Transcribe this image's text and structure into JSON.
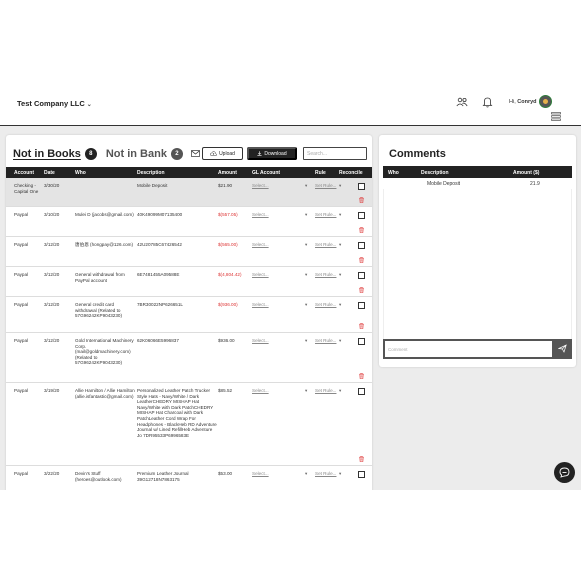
{
  "header": {
    "company": "Test Company LLC",
    "greeting_prefix": "Hi,",
    "user_name": "Conryd"
  },
  "tabs": {
    "not_in_books": {
      "label": "Not in Books",
      "count": "8"
    },
    "not_in_bank": {
      "label": "Not in Bank",
      "count": "2"
    }
  },
  "toolbar": {
    "upload_label": "Upload",
    "download_label": "Download",
    "search_placeholder": "Search..."
  },
  "table": {
    "columns": [
      "Account",
      "Date",
      "Who",
      "Description",
      "Amount",
      "GL Account",
      "Rule",
      "Reconcile"
    ],
    "rows": [
      {
        "account": "Checking - Capital One",
        "date": "3/30/20",
        "who": "",
        "description": "Mobile Deposit",
        "amount": "$21.90",
        "negative": false,
        "gl": "Select...",
        "rule": "Set Rule..."
      },
      {
        "account": "Paypal",
        "date": "3/10/20",
        "who": "Mulei D (jacobs@gmail.com)",
        "description": "40K49099M07135400",
        "amount": "$(557.05)",
        "negative": true,
        "gl": "Select...",
        "rule": "Set Rule..."
      },
      {
        "account": "Paypal",
        "date": "3/12/20",
        "who": "唐伯恩 (hongpay@126.com)",
        "description": "42U20785C67426542",
        "amount": "$(565.00)",
        "negative": true,
        "gl": "Select...",
        "rule": "Set Rule..."
      },
      {
        "account": "Paypal",
        "date": "3/12/20",
        "who": "General withdrawal from PayPal account",
        "description": "6E7481455A09588E",
        "amount": "$(4,804.42)",
        "negative": true,
        "gl": "Select...",
        "rule": "Set Rule..."
      },
      {
        "account": "Paypal",
        "date": "3/12/20",
        "who": "General credit card withdrawal (Related to 57G96242KP9043230)",
        "description": "7BR30022NP626651L",
        "amount": "$(936.00)",
        "negative": true,
        "gl": "Select...",
        "rule": "Set Rule..."
      },
      {
        "account": "Paypal",
        "date": "3/12/20",
        "who": "Gold International Machinery Corp. (mail@goldmachinery.com) (Related to 57G96242KP9043230)",
        "description": "62K06066E5996837",
        "amount": "$936.00",
        "negative": false,
        "gl": "Select...",
        "rule": "Set Rule..."
      },
      {
        "account": "Paypal",
        "date": "3/19/20",
        "who": "Allie Hamilton / Allie Hamilton (allie.isfantastic@gmail.com)",
        "description": "Personalized Leather Patch Trucker Style Hats - Navy/White / Dark LeatherCHEDRY MISHAP Hat Navy/White with Dark PatchCHEDRY MISHAP Hat Charcoal with Dark PatchLeather Cord Wrap For Headphones - BlackHeb RD Adventure Journal w/ Lined RefillHeb Adventure Jo 7DR95533P6996583E",
        "amount": "$85.52",
        "negative": false,
        "gl": "Select...",
        "rule": "Set Rule..."
      },
      {
        "account": "Paypal",
        "date": "3/22/20",
        "who": "Devin's Stuff (heroes@outlook.com)",
        "description": "Premium Leather Journal 39G12718N7863175",
        "amount": "$53.00",
        "negative": false,
        "gl": "Select...",
        "rule": "Set Rule..."
      }
    ]
  },
  "comments": {
    "title": "Comments",
    "columns": [
      "Who",
      "Description",
      "Amount ($)"
    ],
    "rows": [
      {
        "who": "",
        "description": "Mobile Deposit",
        "amount": "21.9"
      }
    ],
    "input_placeholder": "Comment"
  },
  "icons": [
    "people-icon",
    "bell-icon",
    "menu-icon",
    "mail-icon",
    "upload-cloud-icon",
    "download-icon",
    "trash-icon",
    "send-icon",
    "chat-icon"
  ],
  "colors": {
    "negative": "#dd3333",
    "dark": "#222222"
  }
}
